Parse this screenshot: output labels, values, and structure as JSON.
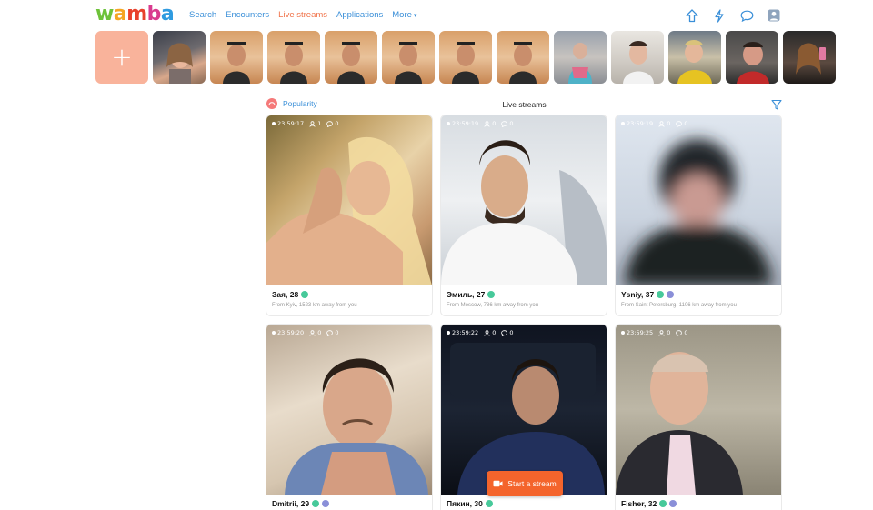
{
  "header": {
    "logo_letters": [
      "w",
      "a",
      "m",
      "b",
      "a"
    ],
    "nav": [
      {
        "label": "Search"
      },
      {
        "label": "Encounters"
      },
      {
        "label": "Live streams"
      },
      {
        "label": "Applications"
      },
      {
        "label": "More"
      }
    ],
    "active_nav": "Live streams",
    "icons": [
      "upload-icon",
      "lightning-icon",
      "chat-bubble-icon",
      "user-profile-icon"
    ]
  },
  "stories": {
    "add_label": "+",
    "count": 11
  },
  "filter": {
    "sort_label": "Popularity",
    "title": "Live streams",
    "filter_icon": "funnel-icon"
  },
  "streams": [
    {
      "timer": "23:59:17",
      "viewers": "1",
      "comments": "0",
      "name": "Зая, 28",
      "online": true,
      "verified": false,
      "location": "From Kyiv, 1523 km away from you"
    },
    {
      "timer": "23:59:19",
      "viewers": "0",
      "comments": "0",
      "name": "Эмиль, 27",
      "online": true,
      "verified": false,
      "location": "From Moscow, 786 km away from you"
    },
    {
      "timer": "23:59:19",
      "viewers": "0",
      "comments": "0",
      "name": "Ysniy, 37",
      "online": true,
      "verified": true,
      "location": "From Saint Petersburg, 1106 km away from you"
    },
    {
      "timer": "23:59:20",
      "viewers": "0",
      "comments": "0",
      "name": "Dmitrii, 29",
      "online": true,
      "verified": true,
      "location": ""
    },
    {
      "timer": "23:59:22",
      "viewers": "0",
      "comments": "0",
      "name": "Пякин, 30",
      "online": true,
      "verified": false,
      "location": ""
    },
    {
      "timer": "23:59:25",
      "viewers": "0",
      "comments": "0",
      "name": "Fisher, 32",
      "online": true,
      "verified": true,
      "location": ""
    }
  ],
  "start_stream": {
    "label": "Start a stream",
    "icon": "video-camera-icon"
  },
  "colors": {
    "accent_orange": "#f4642c",
    "link_blue": "#3a8fd8",
    "online_green": "#47c99a"
  }
}
